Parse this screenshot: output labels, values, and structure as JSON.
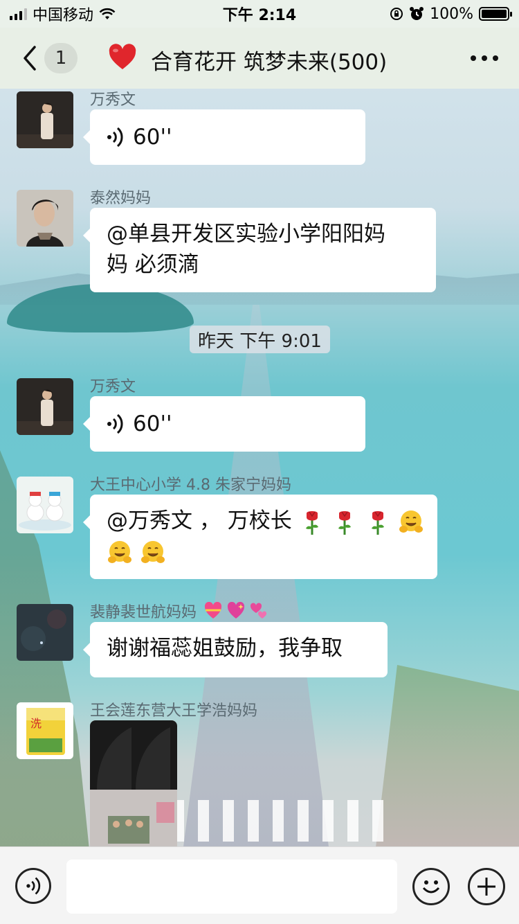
{
  "status_bar": {
    "carrier": "中国移动",
    "time": "下午 2:14",
    "battery": "100%"
  },
  "nav": {
    "unread_count": "1",
    "title": "合育花开 筑梦未来(500)"
  },
  "messages": [
    {
      "sender": "万秀文",
      "type": "voice",
      "duration": "60''"
    },
    {
      "sender": "泰然妈妈",
      "type": "text",
      "line1": "@单县开发区实验小学阳阳妈",
      "line2": "妈 必须滴"
    },
    {
      "type": "timestamp",
      "text": "昨天 下午 9:01"
    },
    {
      "sender": "万秀文",
      "type": "voice",
      "duration": "60''"
    },
    {
      "sender": "大王中心小学 4.8 朱家宁妈妈",
      "type": "text",
      "line1": "@万秀文 ， 万校长",
      "emoji_line1": [
        "rose-icon",
        "rose-icon",
        "rose-icon",
        "hugging-face-icon"
      ],
      "emoji_line2": [
        "hugging-face-icon",
        "hugging-face-icon"
      ]
    },
    {
      "sender": "裴静裴世航妈妈",
      "sender_emoji": [
        "heart-ribbon-icon",
        "sparkling-heart-icon",
        "revolving-hearts-icon"
      ],
      "type": "text",
      "line1": "谢谢福蕊姐鼓励，我争取"
    },
    {
      "sender": "王会莲东营大王学浩妈妈",
      "type": "image"
    }
  ],
  "colors": {
    "bubble": "#ffffff",
    "nav_bg": "#e8efe6",
    "input_bar_bg": "#f4f4f4"
  }
}
